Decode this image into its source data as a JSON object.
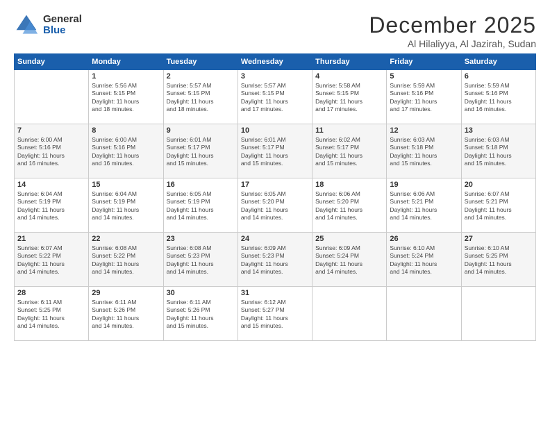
{
  "logo": {
    "general": "General",
    "blue": "Blue"
  },
  "title": "December 2025",
  "location": "Al Hilaliyya, Al Jazirah, Sudan",
  "days_of_week": [
    "Sunday",
    "Monday",
    "Tuesday",
    "Wednesday",
    "Thursday",
    "Friday",
    "Saturday"
  ],
  "weeks": [
    [
      {
        "day": "",
        "info": ""
      },
      {
        "day": "1",
        "info": "Sunrise: 5:56 AM\nSunset: 5:15 PM\nDaylight: 11 hours\nand 18 minutes."
      },
      {
        "day": "2",
        "info": "Sunrise: 5:57 AM\nSunset: 5:15 PM\nDaylight: 11 hours\nand 18 minutes."
      },
      {
        "day": "3",
        "info": "Sunrise: 5:57 AM\nSunset: 5:15 PM\nDaylight: 11 hours\nand 17 minutes."
      },
      {
        "day": "4",
        "info": "Sunrise: 5:58 AM\nSunset: 5:15 PM\nDaylight: 11 hours\nand 17 minutes."
      },
      {
        "day": "5",
        "info": "Sunrise: 5:59 AM\nSunset: 5:16 PM\nDaylight: 11 hours\nand 17 minutes."
      },
      {
        "day": "6",
        "info": "Sunrise: 5:59 AM\nSunset: 5:16 PM\nDaylight: 11 hours\nand 16 minutes."
      }
    ],
    [
      {
        "day": "7",
        "info": "Sunrise: 6:00 AM\nSunset: 5:16 PM\nDaylight: 11 hours\nand 16 minutes."
      },
      {
        "day": "8",
        "info": "Sunrise: 6:00 AM\nSunset: 5:16 PM\nDaylight: 11 hours\nand 16 minutes."
      },
      {
        "day": "9",
        "info": "Sunrise: 6:01 AM\nSunset: 5:17 PM\nDaylight: 11 hours\nand 15 minutes."
      },
      {
        "day": "10",
        "info": "Sunrise: 6:01 AM\nSunset: 5:17 PM\nDaylight: 11 hours\nand 15 minutes."
      },
      {
        "day": "11",
        "info": "Sunrise: 6:02 AM\nSunset: 5:17 PM\nDaylight: 11 hours\nand 15 minutes."
      },
      {
        "day": "12",
        "info": "Sunrise: 6:03 AM\nSunset: 5:18 PM\nDaylight: 11 hours\nand 15 minutes."
      },
      {
        "day": "13",
        "info": "Sunrise: 6:03 AM\nSunset: 5:18 PM\nDaylight: 11 hours\nand 15 minutes."
      }
    ],
    [
      {
        "day": "14",
        "info": "Sunrise: 6:04 AM\nSunset: 5:19 PM\nDaylight: 11 hours\nand 14 minutes."
      },
      {
        "day": "15",
        "info": "Sunrise: 6:04 AM\nSunset: 5:19 PM\nDaylight: 11 hours\nand 14 minutes."
      },
      {
        "day": "16",
        "info": "Sunrise: 6:05 AM\nSunset: 5:19 PM\nDaylight: 11 hours\nand 14 minutes."
      },
      {
        "day": "17",
        "info": "Sunrise: 6:05 AM\nSunset: 5:20 PM\nDaylight: 11 hours\nand 14 minutes."
      },
      {
        "day": "18",
        "info": "Sunrise: 6:06 AM\nSunset: 5:20 PM\nDaylight: 11 hours\nand 14 minutes."
      },
      {
        "day": "19",
        "info": "Sunrise: 6:06 AM\nSunset: 5:21 PM\nDaylight: 11 hours\nand 14 minutes."
      },
      {
        "day": "20",
        "info": "Sunrise: 6:07 AM\nSunset: 5:21 PM\nDaylight: 11 hours\nand 14 minutes."
      }
    ],
    [
      {
        "day": "21",
        "info": "Sunrise: 6:07 AM\nSunset: 5:22 PM\nDaylight: 11 hours\nand 14 minutes."
      },
      {
        "day": "22",
        "info": "Sunrise: 6:08 AM\nSunset: 5:22 PM\nDaylight: 11 hours\nand 14 minutes."
      },
      {
        "day": "23",
        "info": "Sunrise: 6:08 AM\nSunset: 5:23 PM\nDaylight: 11 hours\nand 14 minutes."
      },
      {
        "day": "24",
        "info": "Sunrise: 6:09 AM\nSunset: 5:23 PM\nDaylight: 11 hours\nand 14 minutes."
      },
      {
        "day": "25",
        "info": "Sunrise: 6:09 AM\nSunset: 5:24 PM\nDaylight: 11 hours\nand 14 minutes."
      },
      {
        "day": "26",
        "info": "Sunrise: 6:10 AM\nSunset: 5:24 PM\nDaylight: 11 hours\nand 14 minutes."
      },
      {
        "day": "27",
        "info": "Sunrise: 6:10 AM\nSunset: 5:25 PM\nDaylight: 11 hours\nand 14 minutes."
      }
    ],
    [
      {
        "day": "28",
        "info": "Sunrise: 6:11 AM\nSunset: 5:25 PM\nDaylight: 11 hours\nand 14 minutes."
      },
      {
        "day": "29",
        "info": "Sunrise: 6:11 AM\nSunset: 5:26 PM\nDaylight: 11 hours\nand 14 minutes."
      },
      {
        "day": "30",
        "info": "Sunrise: 6:11 AM\nSunset: 5:26 PM\nDaylight: 11 hours\nand 15 minutes."
      },
      {
        "day": "31",
        "info": "Sunrise: 6:12 AM\nSunset: 5:27 PM\nDaylight: 11 hours\nand 15 minutes."
      },
      {
        "day": "",
        "info": ""
      },
      {
        "day": "",
        "info": ""
      },
      {
        "day": "",
        "info": ""
      }
    ]
  ]
}
